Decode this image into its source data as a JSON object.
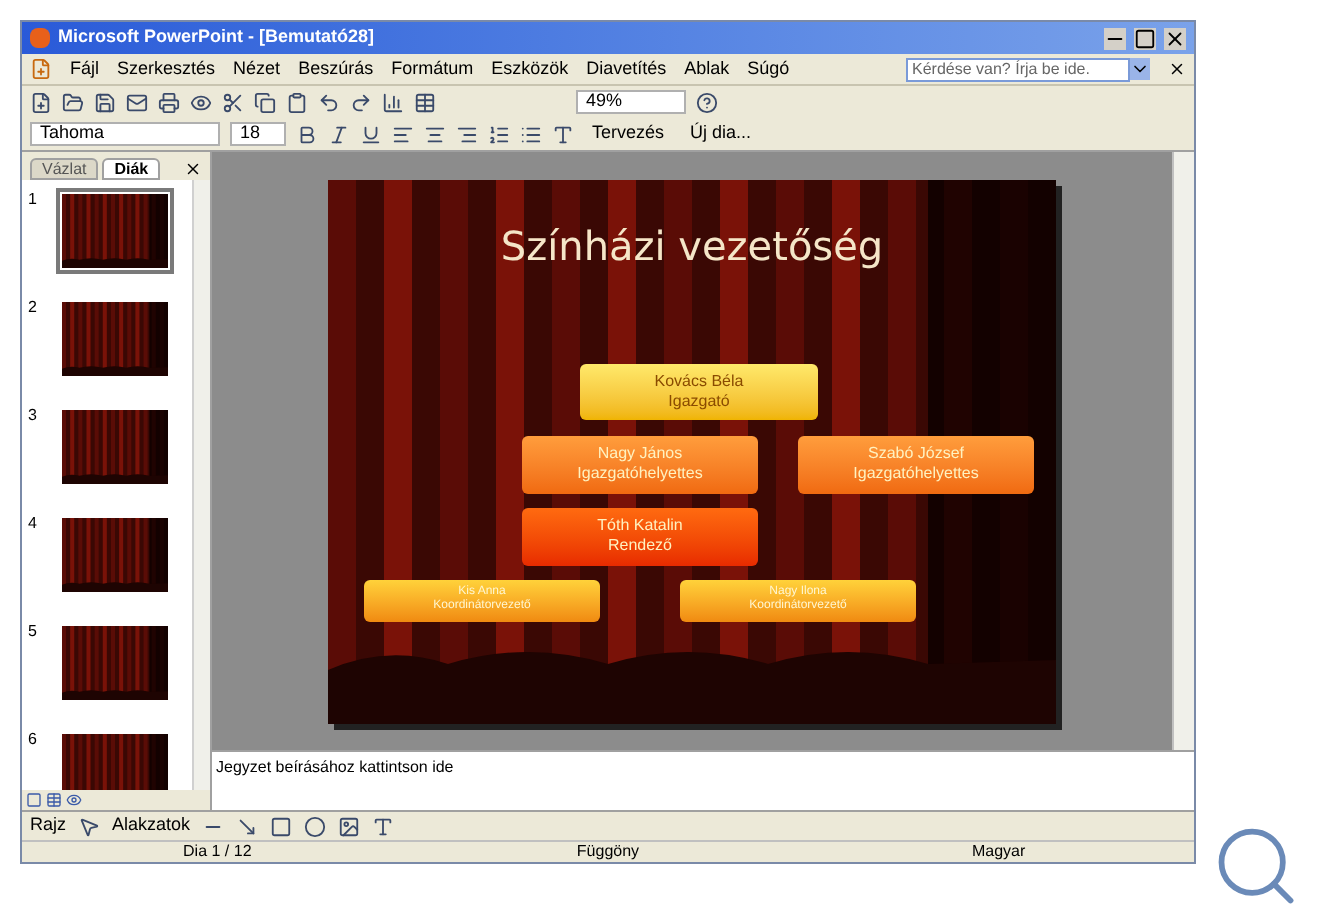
{
  "window": {
    "title": "Microsoft PowerPoint - [Bemutató28]"
  },
  "menu": [
    "Fájl",
    "Szerkesztés",
    "Nézet",
    "Beszúrás",
    "Formátum",
    "Eszközök",
    "Diavetítés",
    "Ablak",
    "Súgó"
  ],
  "help_box": {
    "placeholder": "Kérdése van? Írja be ide."
  },
  "formatting": {
    "font": "Tahoma",
    "size": "18",
    "zoom": "49%",
    "design_button": "Tervezés",
    "new_slide_button": "Új dia..."
  },
  "panel_tabs": [
    {
      "label": "Vázlat",
      "selected": false
    },
    {
      "label": "Diák",
      "selected": true
    }
  ],
  "slides": [
    {
      "number": "1",
      "selected": true
    },
    {
      "number": "2",
      "selected": false
    },
    {
      "number": "3",
      "selected": false
    },
    {
      "number": "4",
      "selected": false
    },
    {
      "number": "5",
      "selected": false
    },
    {
      "number": "6",
      "selected": false
    }
  ],
  "slide": {
    "title": "Színházi vezetőség",
    "boxes": [
      {
        "name": "Kovács Béla",
        "role": "Igazgató",
        "kind": "top"
      },
      {
        "name": "Nagy János",
        "role": "Igazgatóhelyettes",
        "kind": "deputy"
      },
      {
        "name": "Szabó József",
        "role": "Igazgatóhelyettes",
        "kind": "deputy"
      },
      {
        "name": "Tóth Katalin",
        "role": "Rendező",
        "kind": "director"
      },
      {
        "name": "Kis Anna",
        "role": "Koordinátorvezető",
        "kind": "small"
      },
      {
        "name": "Nagy Ilona",
        "role": "Koordinátorvezető",
        "kind": "small"
      }
    ]
  },
  "notes": {
    "placeholder": "Jegyzet beírásához kattintson ide"
  },
  "draw_toolbar": {
    "draw_menu": "Rajz",
    "shapes_menu": "Alakzatok"
  },
  "status_bar": [
    "Dia 1 / 12",
    "Függöny",
    "Magyar"
  ]
}
